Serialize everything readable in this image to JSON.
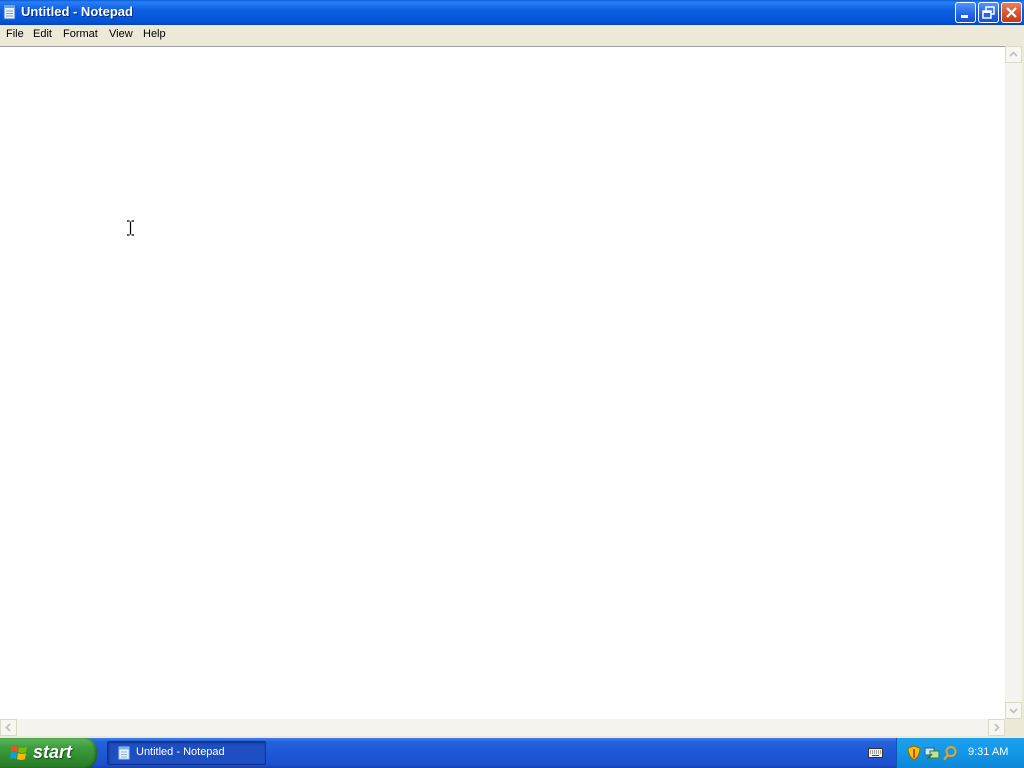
{
  "window": {
    "title": "Untitled - Notepad"
  },
  "menu": {
    "items": [
      "File",
      "Edit",
      "Format",
      "View",
      "Help"
    ]
  },
  "editor": {
    "content": ""
  },
  "taskbar": {
    "start_label": "start",
    "task_button_label": "Untitled - Notepad",
    "clock": "9:31 AM"
  },
  "colors": {
    "titlebar": "#0553d6",
    "taskbar": "#1f58d6",
    "start_button": "#3e9e3e",
    "tray": "#139ae8",
    "close_button": "#d8542b"
  },
  "icons": {
    "app": "notepad-icon",
    "minimize": "minimize-icon",
    "maximize": "restore-icon",
    "close": "close-icon",
    "start": "windows-logo-icon",
    "keyboard": "keyboard-icon",
    "security": "shield-icon",
    "network": "network-icon",
    "search": "magnifier-icon"
  }
}
